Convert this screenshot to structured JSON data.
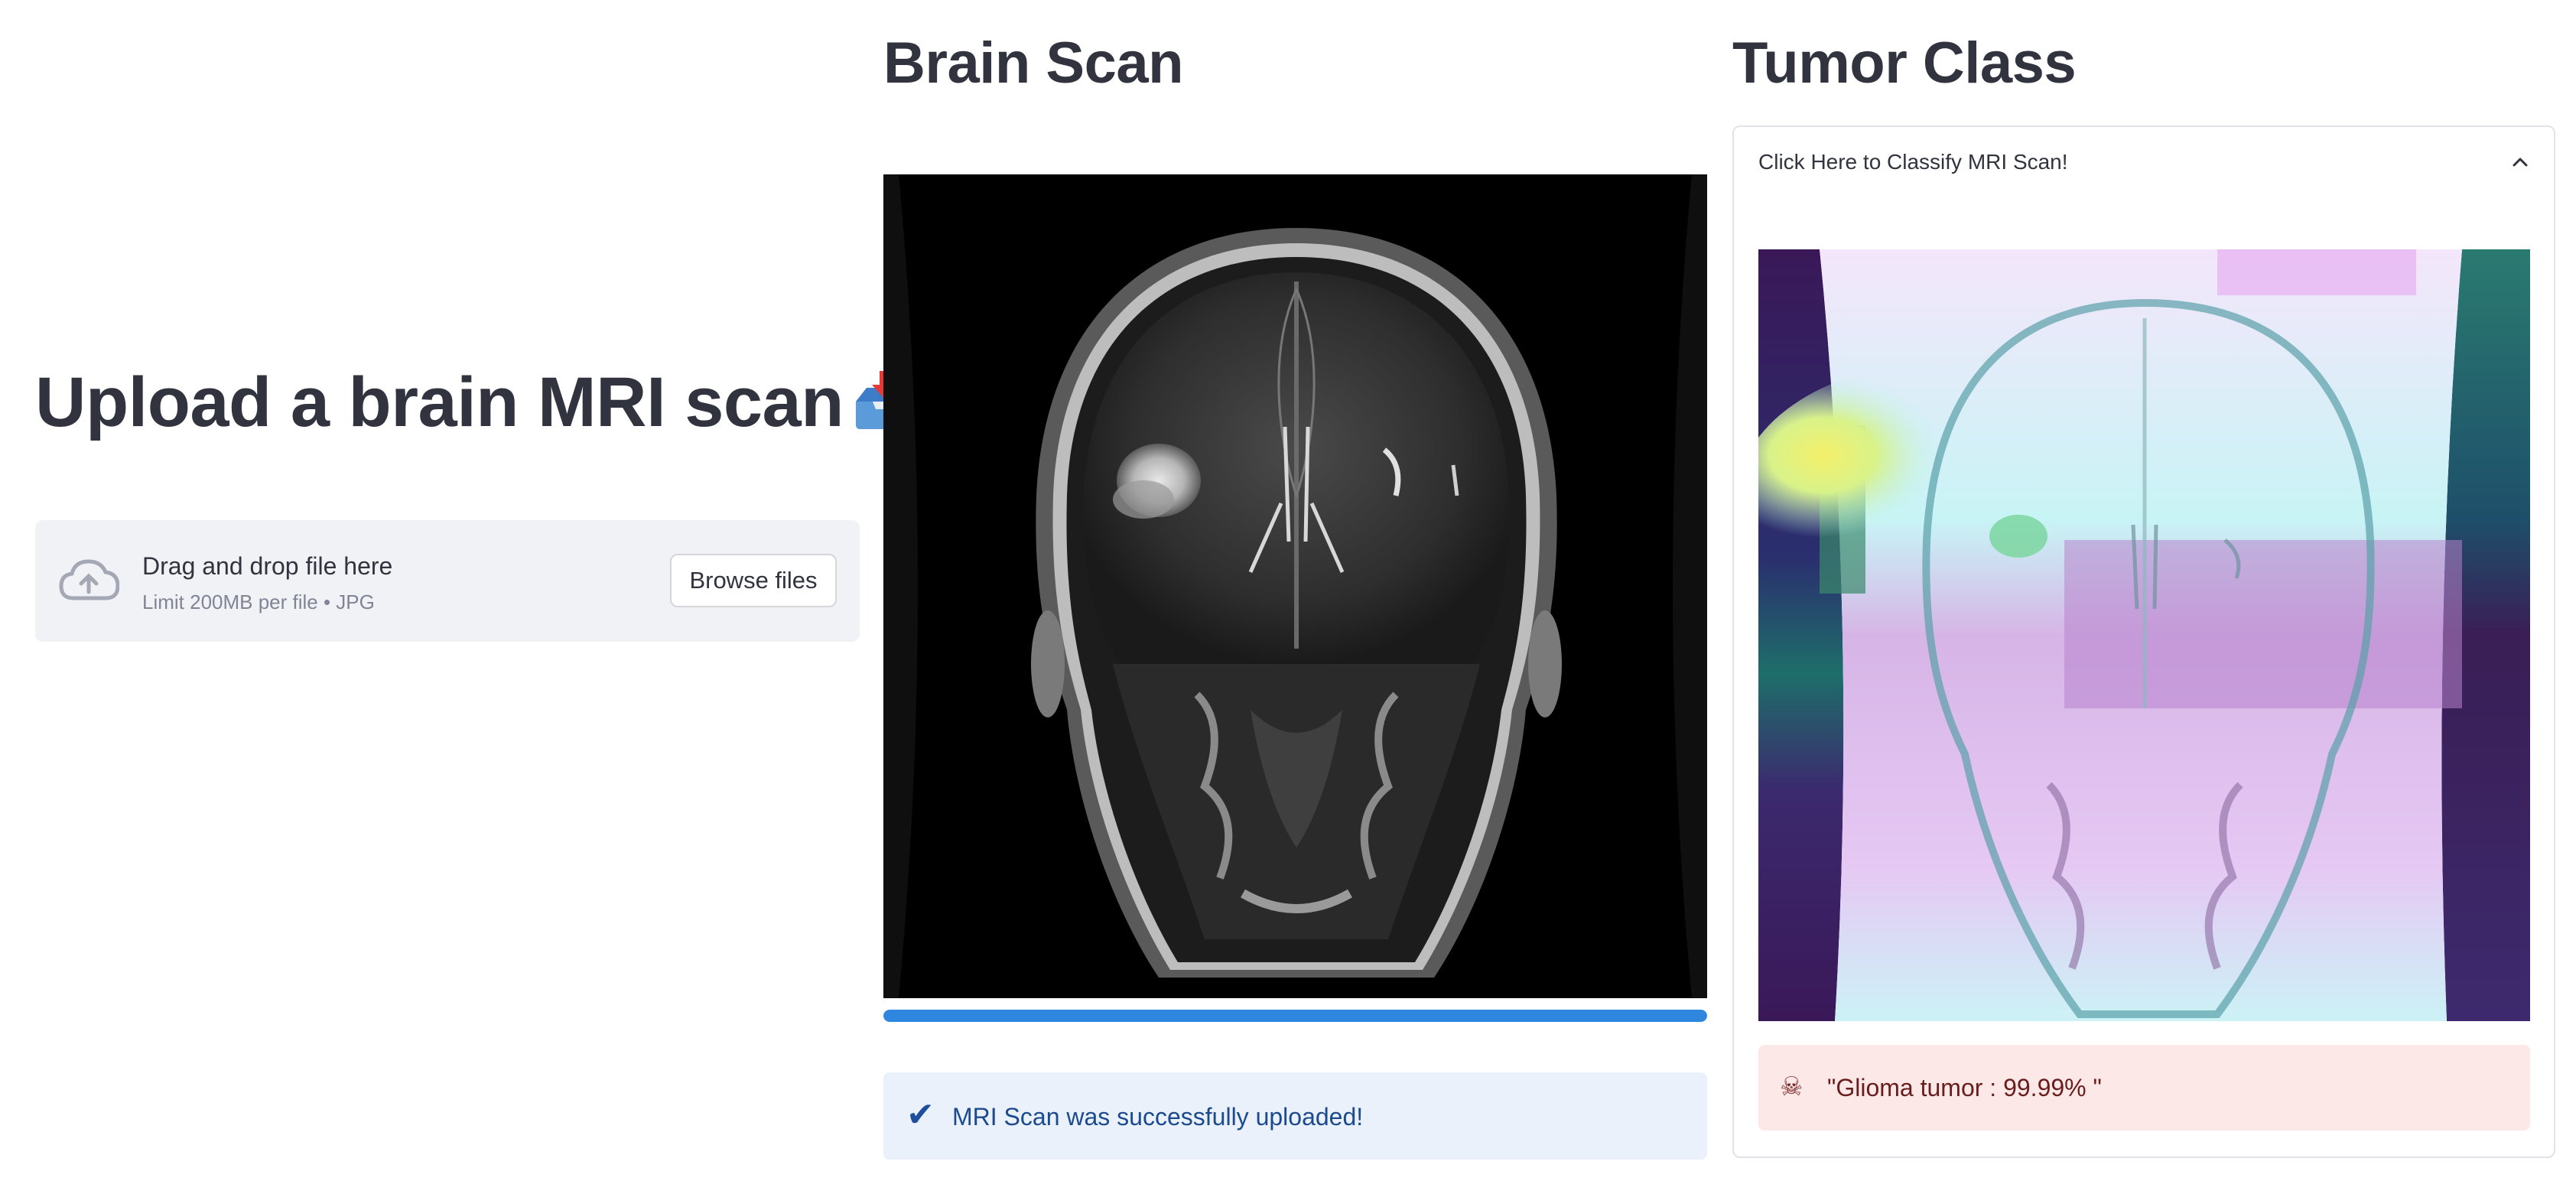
{
  "upload": {
    "title": "Upload a brain MRI scan",
    "title_emoji_icon": "inbox-tray-icon",
    "dropzone_main": "Drag and drop file here",
    "dropzone_sub": "Limit 200MB per file • JPG",
    "browse_label": "Browse files"
  },
  "scan": {
    "title": "Brain Scan",
    "progress_percent": 100,
    "success_message": "MRI Scan was successfully uploaded!",
    "success_icon": "check-icon"
  },
  "classify": {
    "title": "Tumor Class",
    "expander_label": "Click Here to Classify MRI Scan!",
    "expander_icon": "chevron-up-icon",
    "result_icon": "skull-icon",
    "result_text": "\"Glioma tumor : 99.99% \""
  },
  "colors": {
    "accent": "#2e86de",
    "success_bg": "#eaf1fb",
    "error_bg": "#fde8e8",
    "dropzone_bg": "#f0f2f6"
  }
}
